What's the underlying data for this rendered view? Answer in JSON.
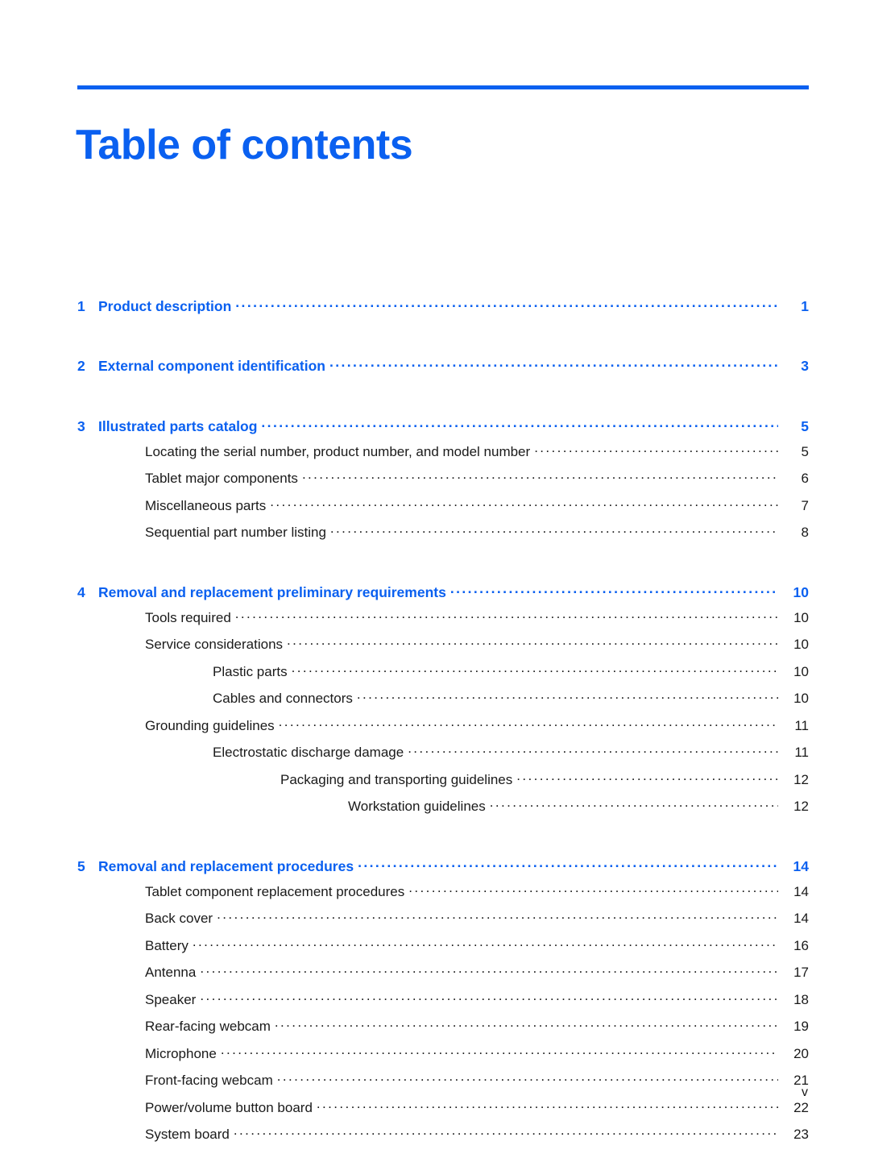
{
  "document": {
    "title": "Table of contents",
    "accent_color": "#0a60f0",
    "body_color": "#1a1a1a",
    "page_number": "v"
  },
  "toc": {
    "entries": [
      {
        "level": 0,
        "number": "1",
        "label": "Product description",
        "page": "1"
      },
      {
        "level": 0,
        "number": "2",
        "label": "External component identification",
        "page": "3"
      },
      {
        "level": 0,
        "number": "3",
        "label": "Illustrated parts catalog",
        "page": "5"
      },
      {
        "level": 1,
        "number": "",
        "label": "Locating the serial number, product number, and model number",
        "page": "5"
      },
      {
        "level": 1,
        "number": "",
        "label": "Tablet major components",
        "page": "6"
      },
      {
        "level": 1,
        "number": "",
        "label": "Miscellaneous parts",
        "page": "7"
      },
      {
        "level": 1,
        "number": "",
        "label": "Sequential part number listing",
        "page": "8"
      },
      {
        "level": 0,
        "number": "4",
        "label": "Removal and replacement preliminary requirements",
        "page": "10"
      },
      {
        "level": 1,
        "number": "",
        "label": "Tools required",
        "page": "10"
      },
      {
        "level": 1,
        "number": "",
        "label": "Service considerations",
        "page": "10"
      },
      {
        "level": 2,
        "number": "",
        "label": "Plastic parts",
        "page": "10"
      },
      {
        "level": 2,
        "number": "",
        "label": "Cables and connectors",
        "page": "10"
      },
      {
        "level": 1,
        "number": "",
        "label": "Grounding guidelines",
        "page": "11"
      },
      {
        "level": 2,
        "number": "",
        "label": "Electrostatic discharge damage",
        "page": "11"
      },
      {
        "level": 3,
        "number": "",
        "label": "Packaging and transporting guidelines",
        "page": "12"
      },
      {
        "level": 4,
        "number": "",
        "label": "Workstation guidelines",
        "page": "12"
      },
      {
        "level": 0,
        "number": "5",
        "label": "Removal and replacement procedures",
        "page": "14"
      },
      {
        "level": 1,
        "number": "",
        "label": "Tablet component replacement procedures",
        "page": "14"
      },
      {
        "level": 1,
        "number": "",
        "label": "Back cover",
        "page": "14"
      },
      {
        "level": 1,
        "number": "",
        "label": "Battery",
        "page": "16"
      },
      {
        "level": 1,
        "number": "",
        "label": "Antenna",
        "page": "17"
      },
      {
        "level": 1,
        "number": "",
        "label": "Speaker",
        "page": "18"
      },
      {
        "level": 1,
        "number": "",
        "label": "Rear-facing webcam",
        "page": "19"
      },
      {
        "level": 1,
        "number": "",
        "label": "Microphone",
        "page": "20"
      },
      {
        "level": 1,
        "number": "",
        "label": "Front-facing webcam",
        "page": "21"
      },
      {
        "level": 1,
        "number": "",
        "label": "Power/volume button board",
        "page": "22"
      },
      {
        "level": 1,
        "number": "",
        "label": "System board",
        "page": "23"
      }
    ]
  }
}
